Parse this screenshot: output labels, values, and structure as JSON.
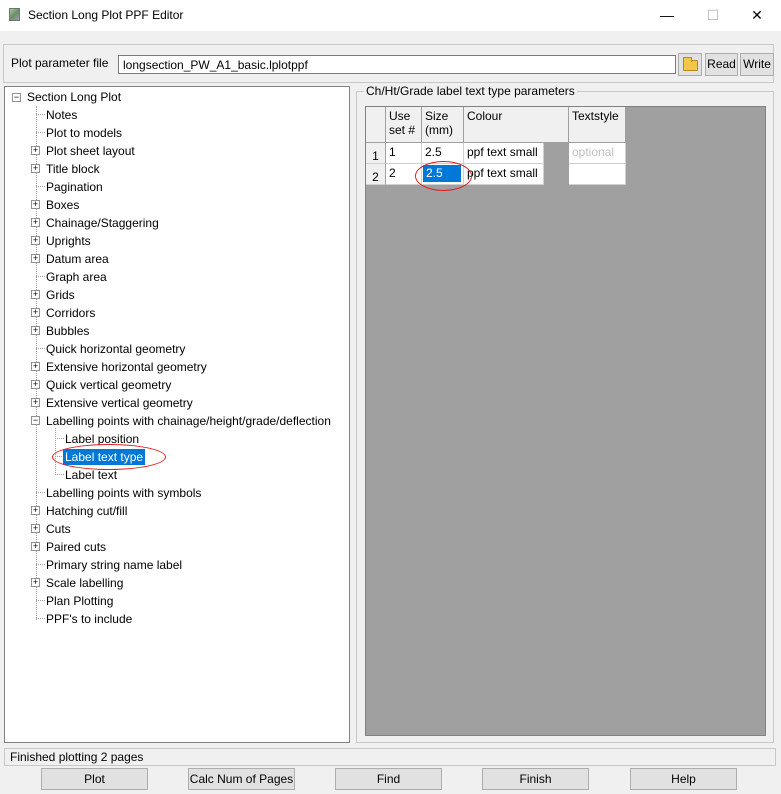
{
  "window": {
    "title": "Section Long Plot PPF Editor",
    "minimize": "—",
    "maximize": "☐",
    "close": "✕"
  },
  "file": {
    "label": "Plot parameter file",
    "value": "longsection_PW_A1_basic.lplotppf",
    "read_label": "Read",
    "write_label": "Write"
  },
  "tree": {
    "root": "Section Long Plot",
    "items": [
      "Notes",
      "Plot to models",
      "Plot sheet layout",
      "Title block",
      "Pagination",
      "Boxes",
      "Chainage/Staggering",
      "Uprights",
      "Datum area",
      "Graph area",
      "Grids",
      "Corridors",
      "Bubbles",
      "Quick horizontal geometry",
      "Extensive horizontal geometry",
      "Quick vertical geometry",
      "Extensive vertical geometry",
      "Labelling points with chainage/height/grade/deflection",
      "Labelling points with symbols",
      "Hatching cut/fill",
      "Cuts",
      "Paired cuts",
      "Primary string name label",
      "Scale labelling",
      "Plan Plotting",
      "PPF's to include"
    ],
    "sub_items": [
      "Label position",
      "Label text type",
      "Label text"
    ]
  },
  "panel": {
    "legend": "Ch/Ht/Grade label text type parameters",
    "headers": {
      "use_set": "Use set #",
      "size": "Size (mm)",
      "colour": "Colour",
      "textstyle": "Textstyle"
    },
    "rows": [
      {
        "num": "1",
        "use_set": "1",
        "size": "2.5",
        "colour": "ppf text small",
        "textstyle": "optional"
      },
      {
        "num": "2",
        "use_set": "2",
        "size": "2.5",
        "colour": "ppf text small",
        "textstyle": ""
      }
    ]
  },
  "status": "Finished plotting 2 pages",
  "buttons": {
    "plot": "Plot",
    "calc": "Calc Num of Pages",
    "find": "Find",
    "finish": "Finish",
    "help": "Help"
  }
}
